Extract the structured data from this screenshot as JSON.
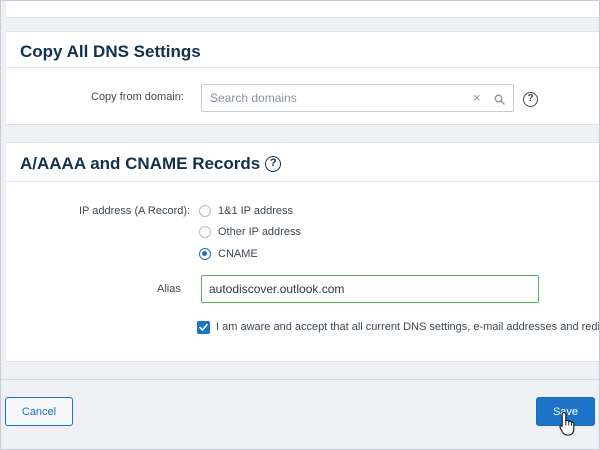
{
  "copy_dns": {
    "title": "Copy All DNS Settings",
    "copy_from_label": "Copy from domain:",
    "search_placeholder": "Search domains",
    "search_value": ""
  },
  "records": {
    "title": "A/AAAA and CNAME Records",
    "ip_label": "IP address (A Record):",
    "options": [
      {
        "label": "1&1 IP address",
        "selected": false
      },
      {
        "label": "Other IP address",
        "selected": false
      },
      {
        "label": "CNAME",
        "selected": true
      }
    ],
    "alias_label": "Alias",
    "alias_value": "autodiscover.outlook.com",
    "consent_checked": true,
    "consent_text": "I am aware and accept that all current DNS settings, e-mail addresses and redirect"
  },
  "footer": {
    "cancel_label": "Cancel",
    "save_label": "Save"
  },
  "icons": {
    "help": "?",
    "clear": "×"
  },
  "colors": {
    "accent": "#1c73c8",
    "heading": "#10324f",
    "valid_border": "#5bb05b"
  }
}
